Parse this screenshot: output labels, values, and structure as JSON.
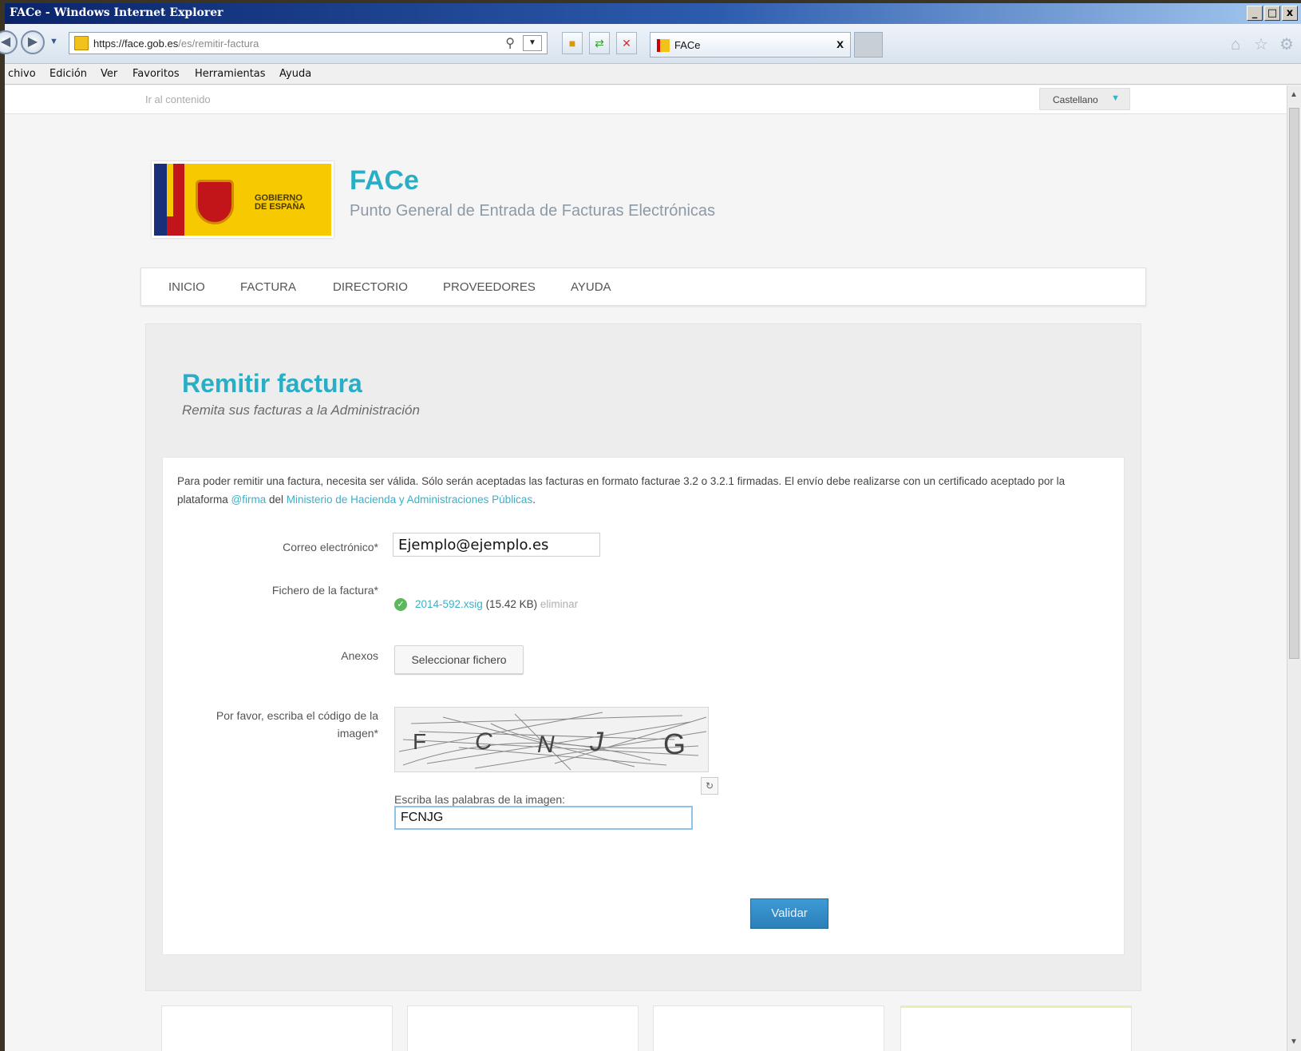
{
  "window": {
    "title": "FACe - Windows Internet Explorer",
    "controls": [
      "_",
      "□",
      "x"
    ]
  },
  "browser": {
    "url_domain": "https://face.gob.es",
    "url_path": "/es/remitir-factura",
    "tab_title": "FACe",
    "tab_close": "x"
  },
  "menu": {
    "items": [
      "chivo",
      "Edición",
      "Ver",
      "Favoritos",
      "Herramientas",
      "Ayuda"
    ]
  },
  "topbar": {
    "skip_link": "Ir al contenido",
    "language": "Castellano"
  },
  "header": {
    "logo_text_line1": "GOBIERNO",
    "logo_text_line2": "DE ESPAÑA",
    "site_name": "FACe",
    "site_tagline": "Punto General de Entrada de Facturas Electrónicas"
  },
  "nav": {
    "items": [
      "INICIO",
      "FACTURA",
      "DIRECTORIO",
      "PROVEEDORES",
      "AYUDA"
    ]
  },
  "main": {
    "title": "Remitir factura",
    "subtitle": "Remita sus facturas a la Administración",
    "intro_part1": "Para poder remitir una factura, necesita ser válida. Sólo serán aceptadas las facturas en formato facturae 3.2 o 3.2.1 firmadas. El envío debe realizarse con un certificado aceptado por la plataforma ",
    "intro_link1": "@firma",
    "intro_part2": " del ",
    "intro_link2": "Ministerio de Hacienda y Administraciones Públicas",
    "intro_part3": "."
  },
  "form": {
    "email_label": "Correo electrónico*",
    "email_value": "Ejemplo@ejemplo.es",
    "invoice_label": "Fichero de la factura*",
    "invoice_filename": "2014-592.xsig",
    "invoice_size": " (15.42 KB) ",
    "invoice_remove": "eliminar",
    "annex_label": "Anexos",
    "annex_button": "Seleccionar fichero",
    "captcha_label": "Por favor, escriba el código de la imagen*",
    "captcha_chars": [
      "F",
      "C",
      "N",
      "J",
      "G"
    ],
    "captcha_input_label": "Escriba las palabras de la imagen:",
    "captcha_value": "FCNJG",
    "submit": "Validar"
  },
  "colors": {
    "accent": "#2aaec6",
    "button": "#2c7fb8",
    "ok": "#5cb85c"
  }
}
